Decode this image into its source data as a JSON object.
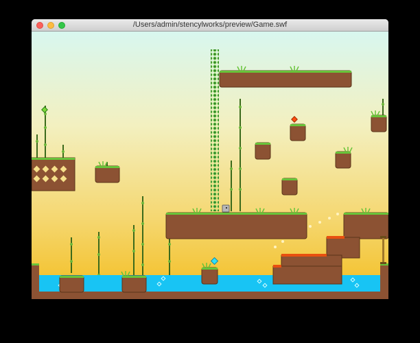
{
  "window": {
    "title": "/Users/admin/stencylworks/preview/Game.swf",
    "controls": {
      "close": "close-icon",
      "minimize": "minimize-icon",
      "zoom": "zoom-icon"
    }
  },
  "game": {
    "colors": {
      "sky_top": "#d8f7ef",
      "sky_bottom": "#f3bd1e",
      "dirt": "#8c5233",
      "grass": "#68c43a",
      "water": "#18c4f4",
      "lava": "#e85010",
      "vine": "#3a8a2a"
    },
    "sprites": [
      "player-icon",
      "gem-icon",
      "flower-icon",
      "spring-icon"
    ]
  }
}
